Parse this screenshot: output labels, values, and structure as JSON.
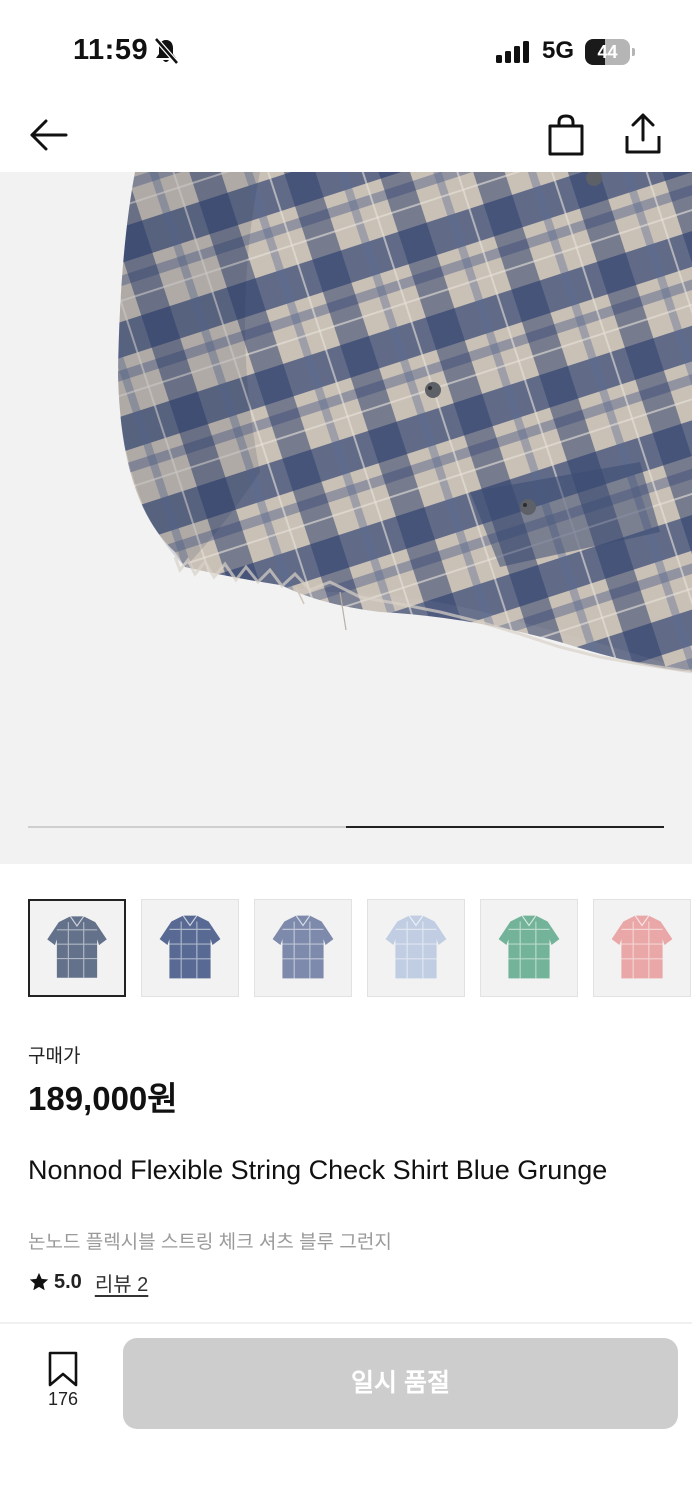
{
  "status_bar": {
    "time": "11:59",
    "network": "5G",
    "battery_level": "44",
    "battery_fraction": 0.44
  },
  "nav": {
    "back_icon": "arrow-left-icon",
    "bag_icon": "shopping-bag-icon",
    "share_icon": "share-icon"
  },
  "gallery": {
    "progress_fraction": 0.5,
    "thumbnails": [
      {
        "color": "#4a5a78",
        "active": true
      },
      {
        "color": "#3d5283",
        "active": false
      },
      {
        "color": "#6878a0",
        "active": false
      },
      {
        "color": "#b7c7df",
        "active": false
      },
      {
        "color": "#5da88a",
        "active": false
      },
      {
        "color": "#e89a9a",
        "active": false
      }
    ]
  },
  "price": {
    "label": "구매가",
    "value": "189,000원"
  },
  "product": {
    "title_en": "Nonnod Flexible String Check Shirt Blue Grunge",
    "title_ko": "논노드 플렉시블 스트링 체크 셔츠 블루 그런지",
    "rating": "5.0",
    "review_link": "리뷰 2"
  },
  "bottom_bar": {
    "wish_count": "176",
    "soldout_label": "일시 품절"
  },
  "colors": {
    "button_disabled": "#cdcdcd",
    "hero_bg": "#f2f2f2",
    "text_muted": "#9a9a9a"
  }
}
